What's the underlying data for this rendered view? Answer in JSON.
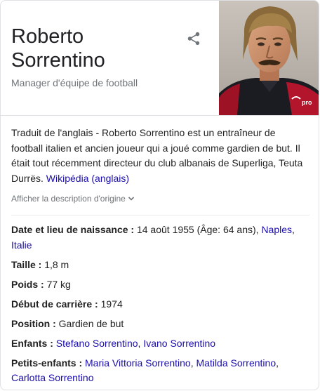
{
  "header": {
    "title_line1": "Roberto",
    "title_line2": "Sorrentino",
    "subtitle": "Manager d'équipe de football"
  },
  "description": {
    "text": "Traduit de l'anglais - Roberto Sorrentino est un entraîneur de football italien et ancien joueur qui a joué comme gardien de but. Il était tout récemment directeur du club albanais de Superliga, Teuta Durrës. ",
    "source_link": "Wikipédia (anglais)",
    "show_original": "Afficher la description d'origine"
  },
  "facts": {
    "birth": {
      "label": "Date et lieu de naissance : ",
      "value": "14 août 1955 (Âge: 64 ans), ",
      "link1": "Naples",
      "sep": ", ",
      "link2": "Italie"
    },
    "height": {
      "label": "Taille : ",
      "value": "1,8 m"
    },
    "weight": {
      "label": "Poids : ",
      "value": "77 kg"
    },
    "career_start": {
      "label": "Début de carrière : ",
      "value": "1974"
    },
    "position": {
      "label": "Position : ",
      "value": "Gardien de but"
    },
    "children": {
      "label": "Enfants : ",
      "link1": "Stefano Sorrentino",
      "sep": ", ",
      "link2": "Ivano Sorrentino"
    },
    "grandchildren": {
      "label": "Petits-enfants : ",
      "link1": "Maria Vittoria Sorrentino",
      "sep1": ", ",
      "link2": "Matilda Sorrentino",
      "sep2": ", ",
      "link3": "Carlotta Sorrentino"
    }
  },
  "photo": {
    "jersey_brand": "uhlsport",
    "jersey_text": "pro"
  },
  "colors": {
    "link": "#1a0dab",
    "muted": "#70757a",
    "border": "#dfe1e5"
  }
}
